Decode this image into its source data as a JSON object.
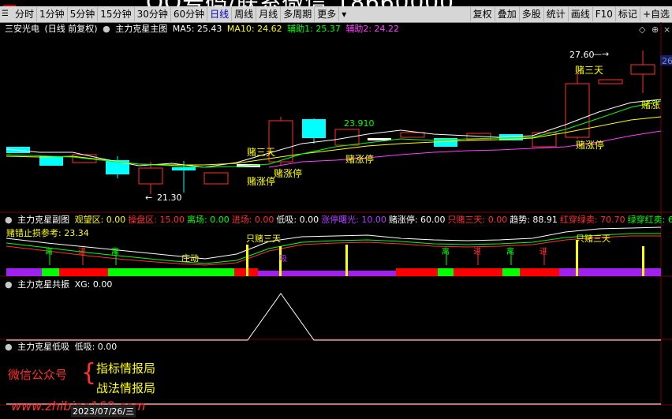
{
  "watermark": "QQ号码/联系微信 18660000",
  "toolbar": {
    "periods": [
      "分时",
      "1分钟",
      "5分钟",
      "15分钟",
      "30分钟",
      "60分钟",
      "日线",
      "周线",
      "月线",
      "多周期",
      "更多"
    ],
    "selected": "日线",
    "right": [
      "复权",
      "叠加",
      "多股",
      "统计",
      "画线",
      "F10",
      "标记",
      "+自选"
    ]
  },
  "main": {
    "stock": "三安光电",
    "mode": "(日线 前复权)",
    "indicator": "主力克星主图",
    "ma5_label": "MA5: 25.43",
    "ma10_label": "MA10: 24.62",
    "aux1_label": "辅助1: 25.37",
    "aux2_label": "辅助2: 24.22",
    "price_labels": {
      "high": "27.60",
      "low": "21.30",
      "mid": "23.910",
      "edge": "26"
    },
    "signals": {
      "buy3_a": "赌三天",
      "buy3_b": "赌三天",
      "zt1": "赌涨停",
      "zt2": "赌涨停",
      "zt3": "赌涨停",
      "zt4": "赌涨停"
    }
  },
  "sub1": {
    "name": "主力克星副图",
    "fields": [
      {
        "text": "观望区: 0.00",
        "color": "#ffff00"
      },
      {
        "text": "操盘区: 15.00",
        "color": "#ff3030"
      },
      {
        "text": "离场: 0.00",
        "color": "#00ff00"
      },
      {
        "text": "进场: 0.00",
        "color": "#ff3030"
      },
      {
        "text": "低吸: 0.00",
        "color": "#ffffff"
      },
      {
        "text": "涨停曙光: 10.00",
        "color": "#b040ff"
      },
      {
        "text": "赌涨停: 60.00",
        "color": "#ffffff"
      },
      {
        "text": "只赌三天: 0.00",
        "color": "#ff3030"
      },
      {
        "text": "趋势: 88.91",
        "color": "#ffffff"
      },
      {
        "text": "红穿绿卖: 70.70",
        "color": "#ff3030"
      },
      {
        "text": "绿穿红卖: 6",
        "color": "#00ff00"
      }
    ],
    "stoploss": "赌错止损参考: 23.34",
    "markers": {
      "li": "离",
      "jin": "进",
      "zhuang": "庄动",
      "only3a": "只赌三天",
      "only3b": "只赌三天"
    }
  },
  "sub2": {
    "name": "主力克星共振",
    "field": "XG: 0.00"
  },
  "sub3": {
    "name": "主力克星低吸",
    "field": "低吸: 0.00"
  },
  "brand": {
    "wx": "微信公众号",
    "line1": "指标情报局",
    "line2": "战法情报局",
    "url": "www.zhibiao168.com",
    "date": "2023/07/26/三"
  },
  "colors": {
    "up": "#ff3030",
    "down": "#00ffff",
    "ma5": "#ffffff",
    "ma10": "#ffff00"
  }
}
